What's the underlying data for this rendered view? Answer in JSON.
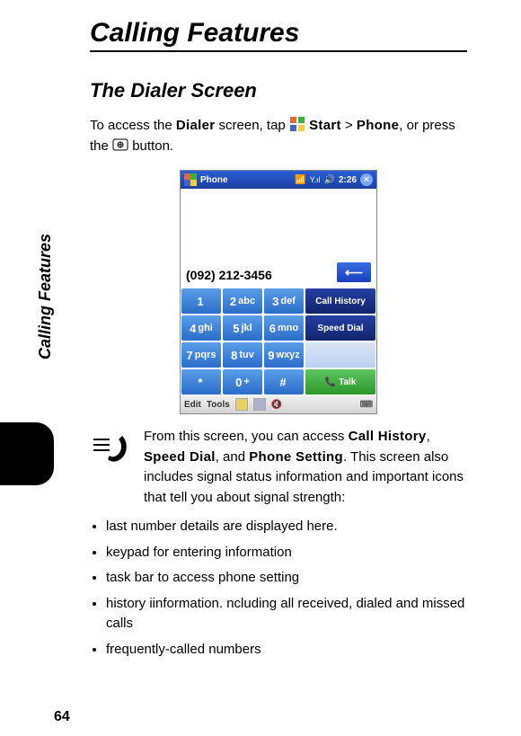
{
  "sideLabel": "Calling Features",
  "pageNumber": "64",
  "title": "Calling Features",
  "subtitle": "The Dialer Screen",
  "intro": {
    "t1": "To access the ",
    "dialer": "Dialer",
    "t2": " screen, tap ",
    "start": "Start",
    "gt": " > ",
    "phone": "Phone",
    "t3": ", or press the ",
    "t4": " button."
  },
  "screenshot": {
    "appTitle": "Phone",
    "time": "2:26",
    "number": "(092) 212-3456",
    "keys": [
      [
        {
          "n": "1",
          "l": ""
        },
        {
          "n": "2",
          "l": "abc"
        },
        {
          "n": "3",
          "l": "def"
        }
      ],
      [
        {
          "n": "4",
          "l": "ghi"
        },
        {
          "n": "5",
          "l": "jkl"
        },
        {
          "n": "6",
          "l": "mno"
        }
      ],
      [
        {
          "n": "7",
          "l": "pqrs"
        },
        {
          "n": "8",
          "l": "tuv"
        },
        {
          "n": "9",
          "l": "wxyz"
        }
      ],
      [
        {
          "n": "*",
          "l": ""
        },
        {
          "n": "0",
          "l": "+"
        },
        {
          "n": "#",
          "l": ""
        }
      ]
    ],
    "sideButtons": [
      "Call History",
      "Speed Dial",
      "",
      "Talk"
    ],
    "bottomBar": {
      "edit": "Edit",
      "tools": "Tools"
    }
  },
  "paragraph": {
    "t1": "From this screen, you can access ",
    "b1": "Call History",
    "c1": ", ",
    "b2": "Speed Dial",
    "c2": ", and ",
    "b3": "Phone Setting",
    "t2": ". This screen also includes signal status information and important icons that tell you about signal strength:"
  },
  "bullets": [
    "last number details are displayed here.",
    "keypad for entering information",
    "task bar to access phone setting",
    "history iinformation. ncluding all received, dialed and missed calls",
    "frequently-called numbers"
  ]
}
